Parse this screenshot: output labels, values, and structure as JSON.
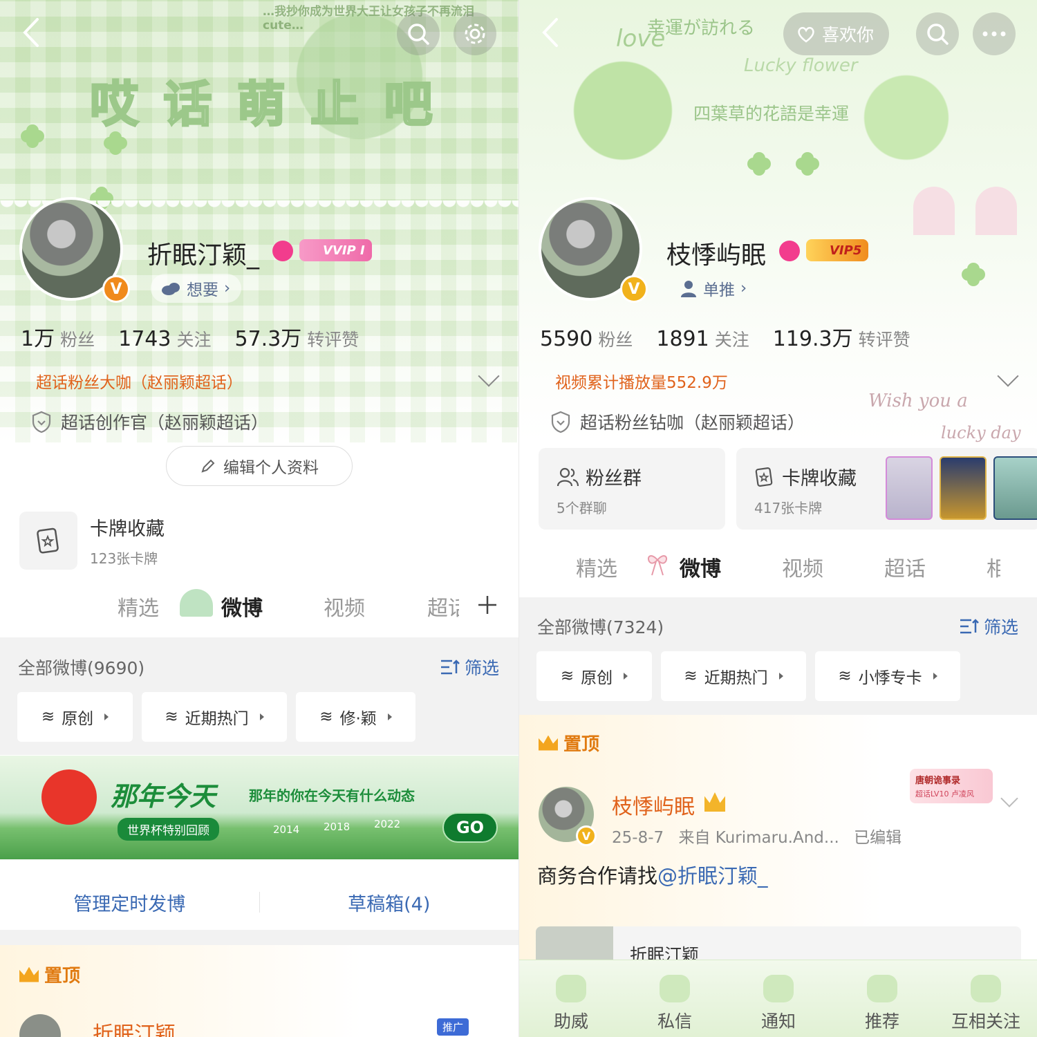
{
  "left": {
    "banner_text": "哎 话 萌 止 吧",
    "banner_top_text": "…我抄你成为世界大王让女孩子不再流泪 cute…",
    "username": "折眠汀颖_",
    "vip_badge": "VVIP I",
    "sub_pill": "想要",
    "stats": [
      {
        "num": "1万",
        "label": "粉丝"
      },
      {
        "num": "1743",
        "label": "关注"
      },
      {
        "num": "57.3万",
        "label": "转评赞"
      }
    ],
    "orange_line": "超话粉丝大咖（赵丽颖超话）",
    "gray_line": "超话创作官（赵丽颖超话）",
    "edit_button": "编辑个人资料",
    "card_collection": {
      "title": "卡牌收藏",
      "sub": "123张卡牌"
    },
    "tabs": [
      "精选",
      "微博",
      "视频",
      "超话"
    ],
    "active_tab": "微博",
    "all_weibo": "全部微博(9690)",
    "filter": "筛选",
    "chips": [
      "原创",
      "近期热门",
      "修·颖"
    ],
    "promo": {
      "title": "那年今天",
      "subtitle": "那年的你在今天有什么动态",
      "tag": "世界杯特别回顾",
      "years": [
        "2014",
        "2018",
        "2022"
      ],
      "go": "GO"
    },
    "manage": [
      "管理定时发博",
      "草稿箱(4)"
    ],
    "pinned_label": "置顶",
    "pinned_name": "折眠汀颖",
    "ad_tag": "推广"
  },
  "right": {
    "banner_text_1": "幸運が訪れる",
    "banner_text_2": "Lucky flower",
    "banner_text_3": "四葉草的花語是幸運",
    "banner_text_4": "love",
    "like_button": "喜欢你",
    "username": "枝悸屿眠",
    "vip_badge": "VIP5",
    "sub_pill": "单推",
    "stats": [
      {
        "num": "5590",
        "label": "粉丝"
      },
      {
        "num": "1891",
        "label": "关注"
      },
      {
        "num": "119.3万",
        "label": "转评赞"
      }
    ],
    "orange_line": "视频累计播放量552.9万",
    "gray_line": "超话粉丝钻咖（赵丽颖超话）",
    "wish_text_1": "Wish you a",
    "wish_text_2": "lucky day",
    "fan_group": {
      "title": "粉丝群",
      "sub": "5个群聊"
    },
    "card_collection": {
      "title": "卡牌收藏",
      "sub": "417张卡牌"
    },
    "tabs": [
      "精选",
      "微博",
      "视频",
      "超话",
      "相"
    ],
    "active_tab": "微博",
    "all_weibo": "全部微博(7324)",
    "filter": "筛选",
    "chips": [
      "原创",
      "近期热门",
      "小悸专卡"
    ],
    "pinned_label": "置顶",
    "post": {
      "name": "枝悸屿眠",
      "date": "25-8-7",
      "source": "来自 Kurimaru.And...",
      "edited": "已编辑",
      "text_prefix": "商务合作请找",
      "mention": "@折眠汀颖_",
      "medal_title": "唐朝诡事录",
      "medal_level": "超话LV10 卢凌风"
    },
    "quoted_name": "折眠汀颖",
    "bottom_bar": [
      "助威",
      "私信",
      "通知",
      "推荐",
      "互相关注"
    ]
  },
  "colors": {
    "orange": "#e0621b",
    "link_blue": "#3a69b3",
    "banner_green": "#cfe6bf",
    "pin_orange": "#e07a10"
  }
}
